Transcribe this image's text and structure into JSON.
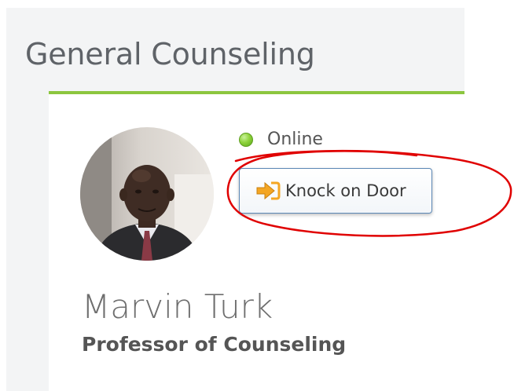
{
  "section": {
    "title": "General Counseling",
    "accent_color": "#8cc63f"
  },
  "profile": {
    "name": "Marvin Turk",
    "job_title": "Professor of Counseling",
    "avatar_icon": "profile-photo"
  },
  "status": {
    "label": "Online",
    "color": "#8fd33c",
    "icon": "status-dot-icon"
  },
  "knock": {
    "label": "Knock on Door",
    "icon": "sign-in-arrow-icon",
    "icon_color": "#f4a623"
  },
  "annotation": {
    "color": "#e00000",
    "shape": "hand-drawn circle around knock button"
  }
}
